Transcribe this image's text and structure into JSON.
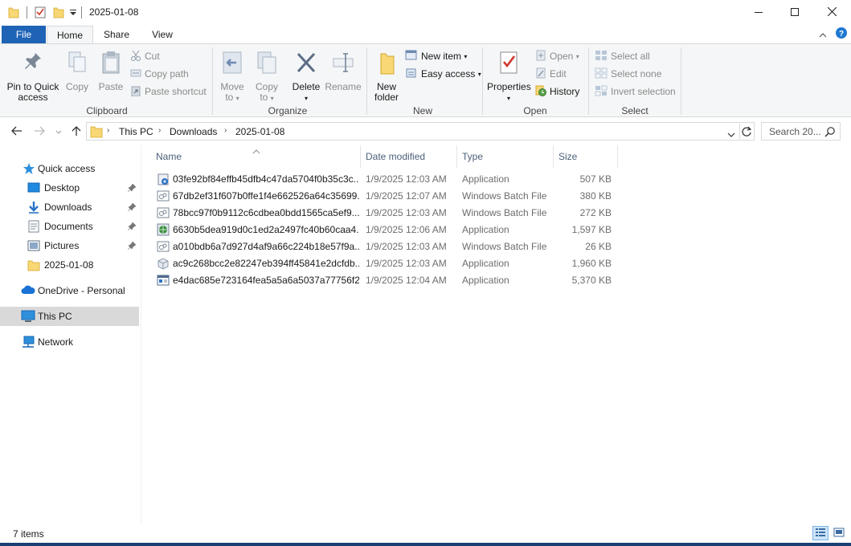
{
  "window": {
    "title": "2025-01-08",
    "minimize_icon": "minimize-icon",
    "maximize_icon": "maximize-icon",
    "close_icon": "close-icon"
  },
  "ribbon_tabs": [
    "File",
    "Home",
    "Share",
    "View"
  ],
  "ribbon": {
    "clipboard": {
      "label": "Clipboard",
      "pin": "Pin to Quick access",
      "pin_line1": "Pin to Quick",
      "pin_line2": "access",
      "copy": "Copy",
      "paste": "Paste",
      "cut": "Cut",
      "copy_path": "Copy path",
      "paste_shortcut": "Paste shortcut"
    },
    "organize": {
      "label": "Organize",
      "move_to_1": "Move",
      "move_to_2": "to",
      "copy_to_1": "Copy",
      "copy_to_2": "to",
      "delete": "Delete",
      "rename": "Rename"
    },
    "new": {
      "label": "New",
      "new_folder_1": "New",
      "new_folder_2": "folder",
      "new_item": "New item",
      "easy_access": "Easy access"
    },
    "open": {
      "label": "Open",
      "properties": "Properties",
      "open": "Open",
      "edit": "Edit",
      "history": "History"
    },
    "select": {
      "label": "Select",
      "select_all": "Select all",
      "select_none": "Select none",
      "invert": "Invert selection"
    }
  },
  "address": {
    "crumbs": [
      "This PC",
      "Downloads",
      "2025-01-08"
    ],
    "search_placeholder": "Search 20..."
  },
  "sidebar": {
    "items": [
      {
        "label": "Quick access",
        "icon": "star-icon"
      },
      {
        "label": "Desktop",
        "icon": "desktop-icon",
        "pinned": true
      },
      {
        "label": "Downloads",
        "icon": "download-arrow-icon",
        "pinned": true
      },
      {
        "label": "Documents",
        "icon": "documents-icon",
        "pinned": true
      },
      {
        "label": "Pictures",
        "icon": "pictures-icon",
        "pinned": true
      },
      {
        "label": "2025-01-08",
        "icon": "folder-icon"
      },
      {
        "label": "OneDrive - Personal",
        "icon": "cloud-icon"
      },
      {
        "label": "This PC",
        "icon": "computer-icon",
        "selected": true
      },
      {
        "label": "Network",
        "icon": "network-icon"
      }
    ]
  },
  "columns": [
    "Name",
    "Date modified",
    "Type",
    "Size"
  ],
  "files": [
    {
      "name": "03fe92bf84effb45dfb4c47da5704f0b35c3c...",
      "date": "1/9/2025 12:03 AM",
      "type": "Application",
      "size": "507 KB",
      "icon": "app-setup-icon"
    },
    {
      "name": "67db2ef31f607b0ffe1f4e662526a64c35699...",
      "date": "1/9/2025 12:07 AM",
      "type": "Windows Batch File",
      "size": "380 KB",
      "icon": "batch-file-icon"
    },
    {
      "name": "78bcc97f0b9112c6cdbea0bdd1565ca5ef9...",
      "date": "1/9/2025 12:03 AM",
      "type": "Windows Batch File",
      "size": "272 KB",
      "icon": "batch-file-icon"
    },
    {
      "name": "6630b5dea919d0c1ed2a2497fc40b60caa4...",
      "date": "1/9/2025 12:06 AM",
      "type": "Application",
      "size": "1,597 KB",
      "icon": "app-globe-icon"
    },
    {
      "name": "a010bdb6a7d927d4af9a66c224b18e57f9a...",
      "date": "1/9/2025 12:03 AM",
      "type": "Windows Batch File",
      "size": "26 KB",
      "icon": "batch-file-icon"
    },
    {
      "name": "ac9c268bcc2e82247eb394ff45841e2dcfdb...",
      "date": "1/9/2025 12:03 AM",
      "type": "Application",
      "size": "1,960 KB",
      "icon": "app-box-icon"
    },
    {
      "name": "e4dac685e723164fea5a5a6a5037a77756f2...",
      "date": "1/9/2025 12:04 AM",
      "type": "Application",
      "size": "5,370 KB",
      "icon": "app-window-icon"
    }
  ],
  "status": {
    "items_count": "7 items"
  },
  "colors": {
    "file_tab": "#1e63b6",
    "selected_nav": "#d9d9d9",
    "folder": "#f8d775",
    "accent_blue": "#1f78d1"
  }
}
